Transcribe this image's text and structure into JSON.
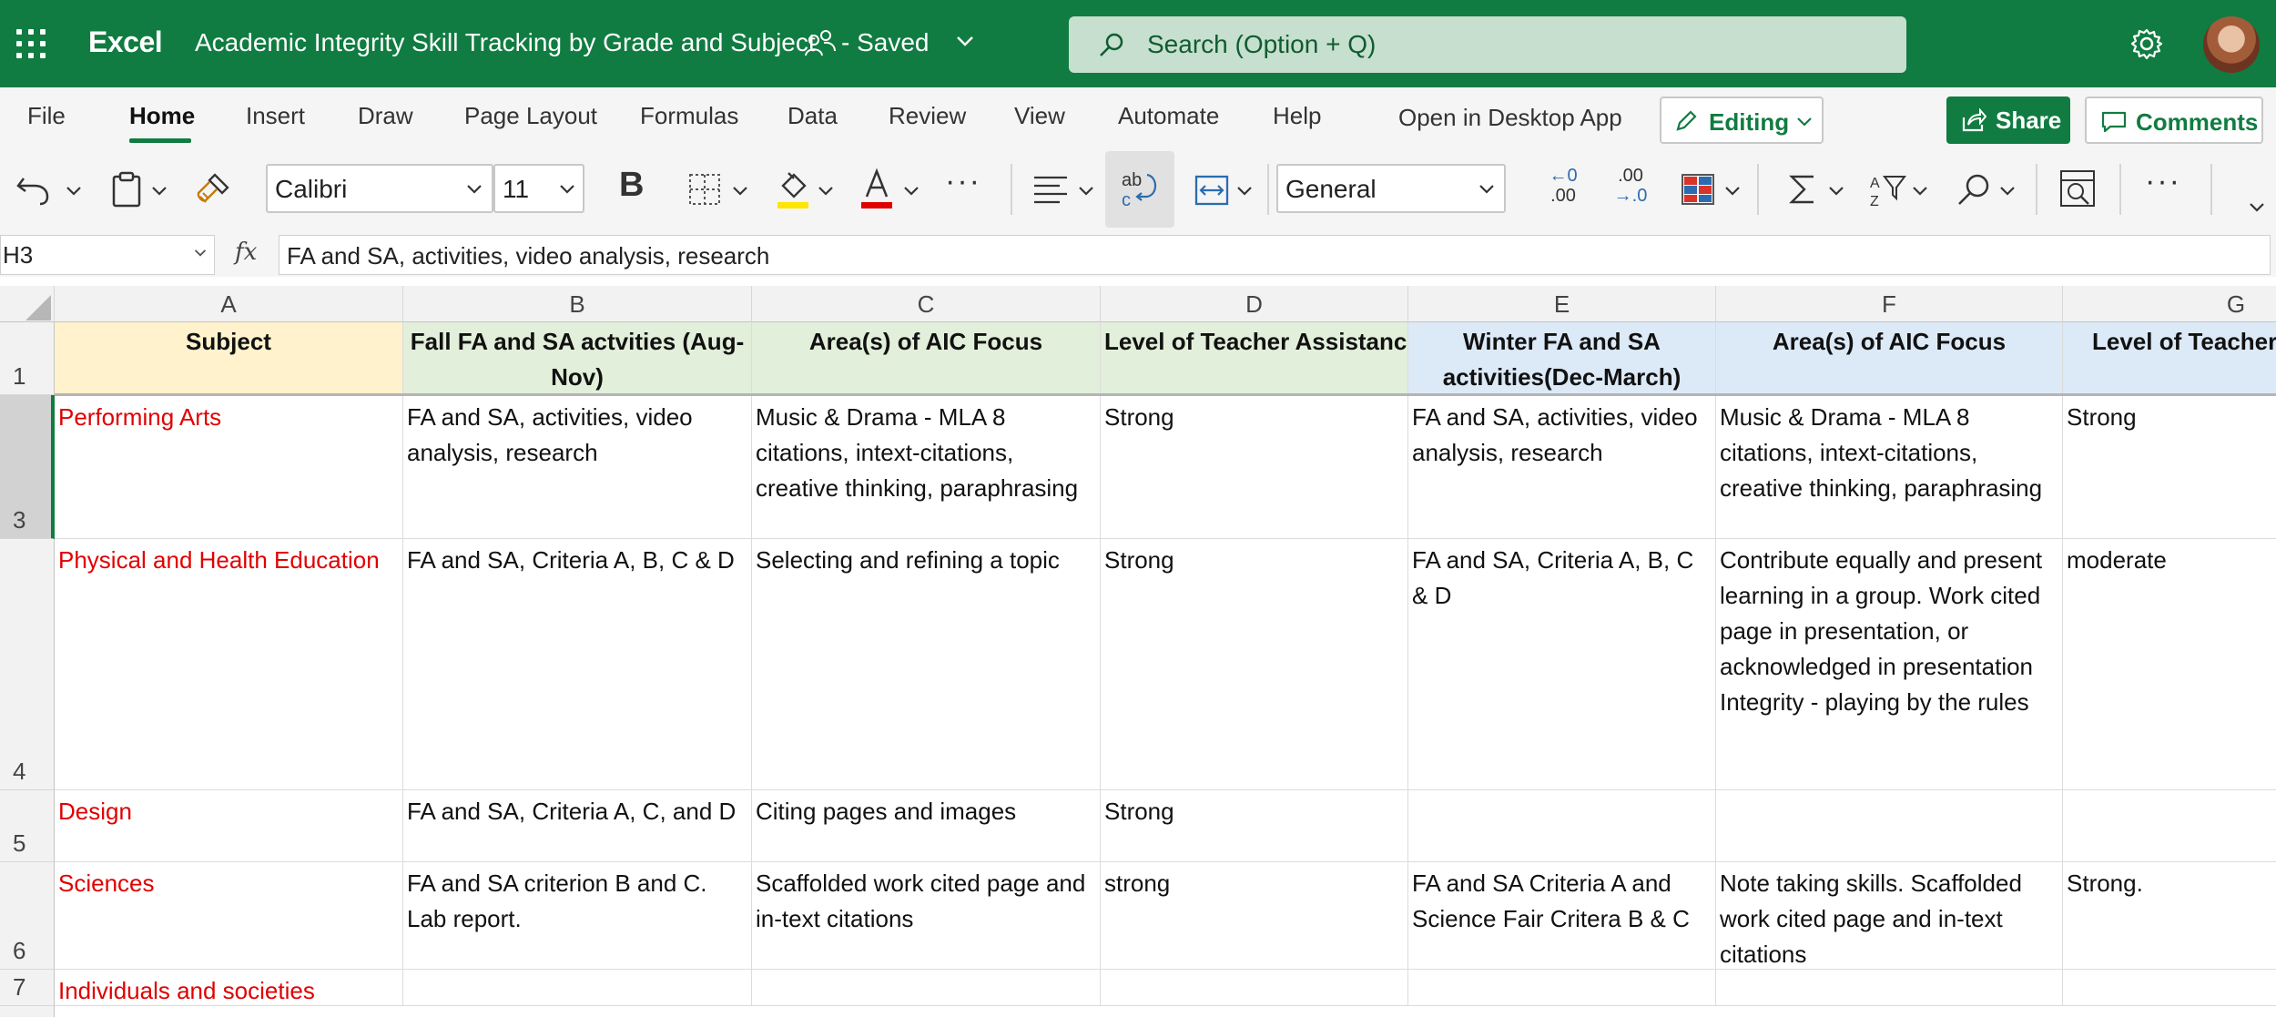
{
  "titlebar": {
    "app_name": "Excel",
    "doc_title": "Academic Integrity Skill Tracking by Grade and Subject",
    "save_status": "-  Saved",
    "search_placeholder": "Search (Option + Q)"
  },
  "menu": {
    "tabs": [
      "File",
      "Home",
      "Insert",
      "Draw",
      "Page Layout",
      "Formulas",
      "Data",
      "Review",
      "View",
      "Automate",
      "Help"
    ],
    "active_tab": "Home",
    "open_desktop": "Open in Desktop App",
    "editing": "Editing",
    "share": "Share",
    "comments": "Comments"
  },
  "ribbon": {
    "font_name": "Calibri",
    "font_size": "11",
    "number_format": "General",
    "decrease_decimal_top": "←0",
    "decrease_decimal_bottom": ".00",
    "increase_decimal_top": ".00",
    "increase_decimal_bottom": "→.0"
  },
  "formula_bar": {
    "name_box": "H3",
    "fx": "fx",
    "content": "FA and SA, activities, video analysis, research"
  },
  "grid": {
    "columns": [
      "A",
      "B",
      "C",
      "D",
      "E",
      "F",
      "G"
    ],
    "row_numbers": [
      "1",
      "3",
      "4",
      "5",
      "6",
      "7"
    ],
    "header_row": [
      "Subject",
      "Fall FA and SA actvities (Aug-Nov)",
      "Area(s) of AIC Focus",
      "Level of  Teacher Assistance",
      "Winter FA and SA activities(Dec-March)",
      "Area(s) of AIC Focus",
      "Level of  Teacher Assistance"
    ],
    "rows": [
      [
        "Performing Arts",
        "FA and SA, activities, video analysis, research",
        "Music & Drama - MLA 8 citations, intext-citations, creative thinking, paraphrasing",
        "Strong",
        "FA and SA, activities, video analysis, research",
        "Music & Drama - MLA 8 citations, intext-citations, creative thinking, paraphrasing",
        "Strong"
      ],
      [
        "Physical and Health Education",
        "FA and SA, Criteria A, B, C & D",
        "Selecting and refining a topic",
        "Strong",
        "FA and SA, Criteria A, B, C & D",
        "Contribute equally and present learning in a group.  Work cited page in presentation, or acknowledged in presentation Integrity - playing by the rules",
        "moderate"
      ],
      [
        "Design",
        "FA and SA, Criteria A, C, and D",
        "Citing pages and images",
        "Strong",
        "",
        "",
        ""
      ],
      [
        "Sciences",
        "FA and SA criterion B and C. Lab report.",
        "Scaffolded work cited page and in-text citations",
        "strong",
        "FA and SA Criteria A and Science Fair Critera B & C",
        "Note taking skills. Scaffolded work cited page and in-text citations",
        "Strong."
      ],
      [
        "Individuals and societies",
        "",
        "",
        "",
        "",
        "",
        ""
      ]
    ]
  }
}
